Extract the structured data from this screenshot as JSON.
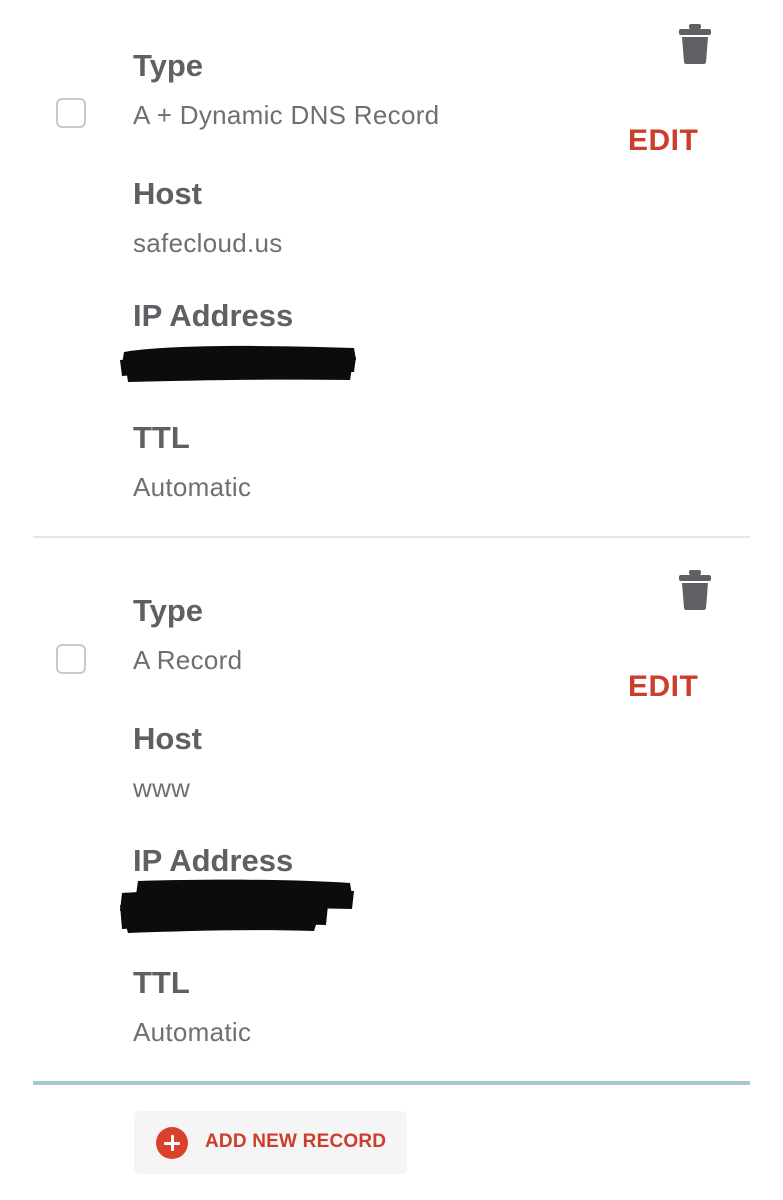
{
  "records": [
    {
      "type_label": "Type",
      "type_value": "A + Dynamic DNS Record",
      "host_label": "Host",
      "host_value": "safecloud.us",
      "ip_label": "IP Address",
      "ttl_label": "TTL",
      "ttl_value": "Automatic",
      "edit_label": "EDIT"
    },
    {
      "type_label": "Type",
      "type_value": "A Record",
      "host_label": "Host",
      "host_value": "www",
      "ip_label": "IP Address",
      "ttl_label": "TTL",
      "ttl_value": "Automatic",
      "edit_label": "EDIT"
    }
  ],
  "add_button": {
    "label": "ADD NEW RECORD"
  },
  "icons": {
    "trash": "trash-icon",
    "add": "plus-circle-icon"
  },
  "colors": {
    "accent": "#cc3d2a",
    "label": "#5f6063",
    "value": "#6e6f72",
    "trash": "#5f6063",
    "divider_active": "#a9c6d3"
  }
}
